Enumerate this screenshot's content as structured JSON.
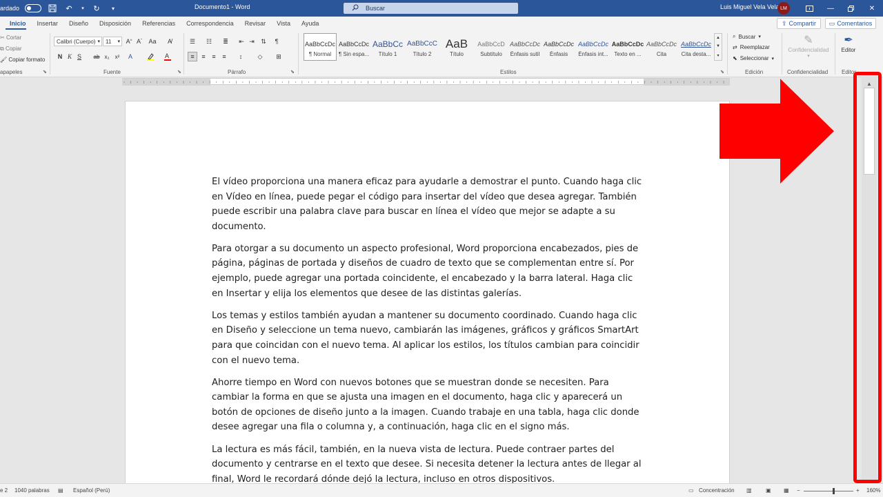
{
  "titlebar": {
    "autosave_label": "ardado",
    "document_title": "Documento1 - Word",
    "search_placeholder": "Buscar",
    "user_name": "Luis Miguel Vela Vela",
    "user_initials": "LM"
  },
  "tabs": [
    "Inicio",
    "Insertar",
    "Diseño",
    "Disposición",
    "Referencias",
    "Correspondencia",
    "Revisar",
    "Vista",
    "Ayuda"
  ],
  "share_label": "Compartir",
  "comments_label": "Comentarios",
  "ribbon": {
    "clipboard": {
      "cut": "Cortar",
      "copy": "Copiar",
      "format_painter": "Copiar formato",
      "label": "apapeles"
    },
    "font": {
      "family": "Calibri (Cuerpo)",
      "size": "11",
      "label": "Fuente"
    },
    "paragraph": {
      "label": "Párrafo"
    },
    "styles": {
      "label": "Estilos",
      "items": [
        {
          "sample": "AaBbCcDc",
          "name": "¶ Normal"
        },
        {
          "sample": "AaBbCcDc",
          "name": "¶ Sin espa..."
        },
        {
          "sample": "AaBbCc",
          "name": "Título 1"
        },
        {
          "sample": "AaBbCcC",
          "name": "Título 2"
        },
        {
          "sample": "AaB",
          "name": "Título"
        },
        {
          "sample": "AaBbCcD",
          "name": "Subtítulo"
        },
        {
          "sample": "AaBbCcDc",
          "name": "Énfasis sutil"
        },
        {
          "sample": "AaBbCcDc",
          "name": "Énfasis"
        },
        {
          "sample": "AaBbCcDc",
          "name": "Énfasis int..."
        },
        {
          "sample": "AaBbCcDc",
          "name": "Texto en ..."
        },
        {
          "sample": "AaBbCcDc",
          "name": "Cita"
        },
        {
          "sample": "AaBbCcDc",
          "name": "Cita desta..."
        }
      ]
    },
    "editing": {
      "find": "Buscar",
      "replace": "Reemplazar",
      "select": "Seleccionar",
      "label": "Edición"
    },
    "sensitivity": {
      "button": "Confidencialidad",
      "label": "Confidencialidad"
    },
    "editor": {
      "button": "Editor",
      "label": "Editor"
    }
  },
  "document": {
    "paragraphs": [
      "El vídeo proporciona una manera eficaz para ayudarle a demostrar el punto. Cuando haga clic en Vídeo en línea, puede pegar el código para insertar del vídeo que desea agregar. También puede escribir una palabra clave para buscar en línea el vídeo que mejor se adapte a su documento.",
      "Para otorgar a su documento un aspecto profesional, Word proporciona encabezados, pies de página, páginas de portada y diseños de cuadro de texto que se complementan entre sí. Por ejemplo, puede agregar una portada coincidente, el encabezado y la barra lateral. Haga clic en Insertar y elija los elementos que desee de las distintas galerías.",
      "Los temas y estilos también ayudan a mantener su documento coordinado. Cuando haga clic en Diseño y seleccione un tema nuevo, cambiarán las imágenes, gráficos y gráficos SmartArt para que coincidan con el nuevo tema. Al aplicar los estilos, los títulos cambian para coincidir con el nuevo tema.",
      "Ahorre tiempo en Word con nuevos botones que se muestran donde se necesiten. Para cambiar la forma en que se ajusta una imagen en el documento, haga clic y aparecerá un botón de opciones de diseño junto a la imagen. Cuando trabaje en una tabla, haga clic donde desee agregar una fila o columna y, a continuación, haga clic en el signo más.",
      "La lectura es más fácil, también, en la nueva vista de lectura. Puede contraer partes del documento y centrarse en el texto que desee. Si necesita detener la lectura antes de llegar al final, Word le recordará dónde dejó la lectura, incluso en otros dispositivos."
    ]
  },
  "statusbar": {
    "page": "e 2",
    "words": "1040 palabras",
    "language": "Español (Perú)",
    "focus": "Concentración",
    "zoom": "160%"
  },
  "colors": {
    "title_bar": "#2b579a",
    "annotation": "#ff0000"
  }
}
